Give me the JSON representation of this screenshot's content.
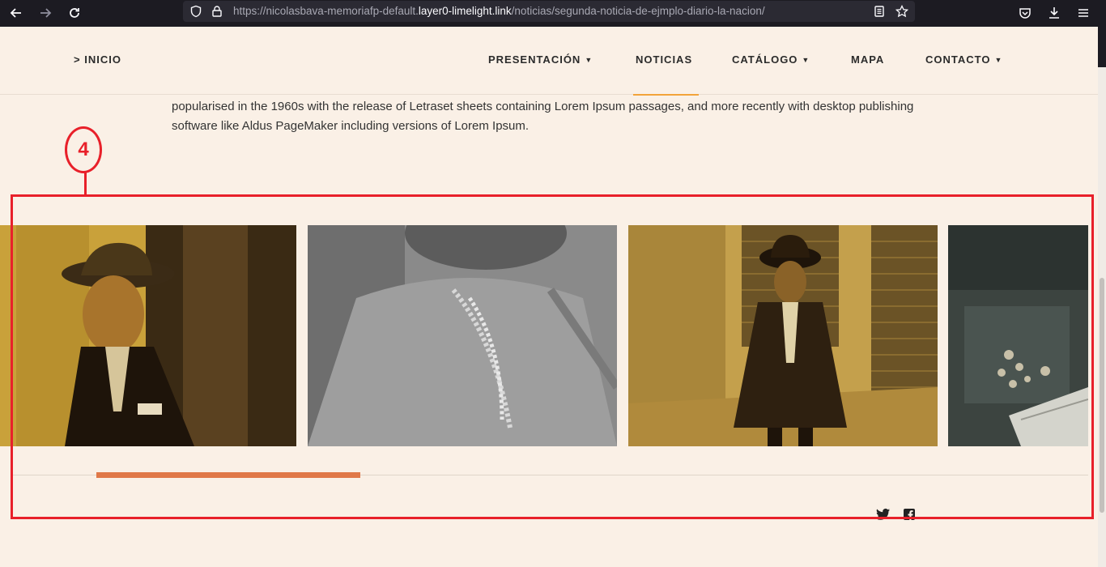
{
  "browser": {
    "url_prefix": "https://nicolasbava-memoriafp-default.",
    "url_host": "layer0-limelight.link",
    "url_path": "/noticias/segunda-noticia-de-ejmplo-diario-la-nacion/"
  },
  "header": {
    "home_link": "> INICIO",
    "nav": [
      {
        "label": "PRESENTACIÓN",
        "has_dropdown": true
      },
      {
        "label": "NOTICIAS",
        "has_dropdown": false,
        "active": true
      },
      {
        "label": "CATÁLOGO",
        "has_dropdown": true
      },
      {
        "label": "MAPA",
        "has_dropdown": false
      },
      {
        "label": "CONTACTO",
        "has_dropdown": true
      }
    ]
  },
  "article": {
    "paragraph_tail": "popularised in the 1960s with the release of Letraset sheets containing Lorem Ipsum passages, and more recently with desktop publishing software like Aldus PageMaker including versions of Lorem Ipsum."
  },
  "annotation": {
    "number": "4",
    "color": "#e8202a"
  },
  "gallery": {
    "images": [
      {
        "description": "sepia photo of a man in a hat and suit",
        "tone": "sepia"
      },
      {
        "description": "grayscale photo of a woman wearing a pearl necklace",
        "tone": "grayscale"
      },
      {
        "description": "sepia photo of a man in a hat standing on a street",
        "tone": "sepia"
      },
      {
        "description": "dark photo of a bouquet of flowers",
        "tone": "dark"
      }
    ],
    "progress": 0.25,
    "accent_color": "#e07848"
  },
  "social": [
    {
      "icon": "twitter-icon"
    },
    {
      "icon": "facebook-icon"
    }
  ]
}
